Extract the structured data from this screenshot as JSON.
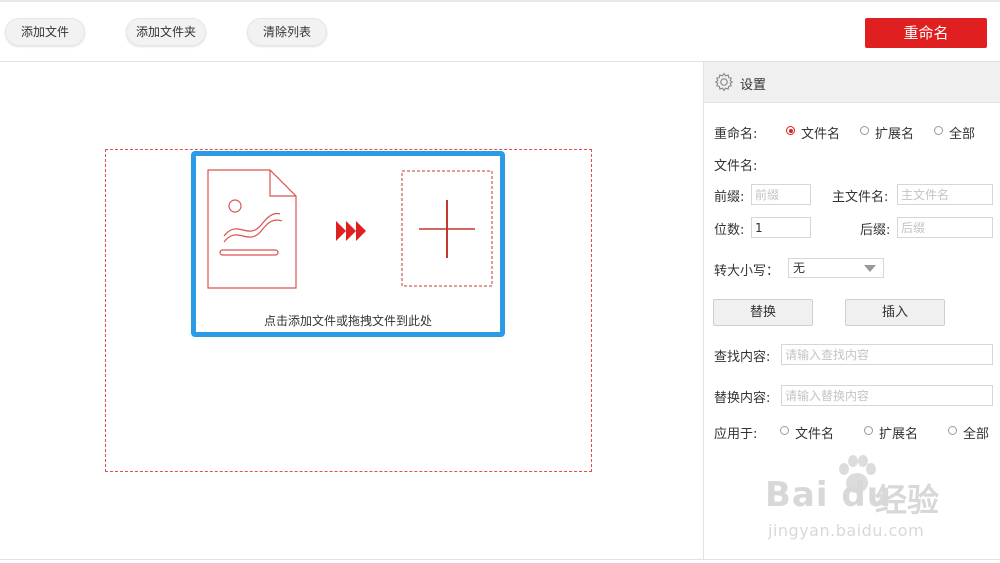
{
  "toolbar": {
    "add_file": "添加文件",
    "add_folder": "添加文件夹",
    "clear_list": "清除列表",
    "rename": "重命名"
  },
  "drop": {
    "hint": "点击添加文件或拖拽文件到此处"
  },
  "settings": {
    "title": "设置",
    "rename_mode_label": "重命名:",
    "rename_modes": [
      "文件名",
      "扩展名",
      "全部"
    ],
    "rename_mode_selected": "文件名",
    "filename_section": "文件名:",
    "prefix_label": "前缀:",
    "prefix_placeholder": "前缀",
    "mainname_label": "主文件名:",
    "mainname_placeholder": "主文件名",
    "digits_label": "位数:",
    "digits_value": "1",
    "suffix_label": "后缀:",
    "suffix_placeholder": "后缀",
    "case_label": "转大小写：",
    "case_value": "无",
    "replace_button": "替换",
    "insert_button": "插入",
    "find_label": "查找内容:",
    "find_placeholder": "请输入查找内容",
    "replace_label": "替换内容:",
    "replace_placeholder": "请输入替换内容",
    "apply_label": "应用于:",
    "apply_options": [
      "文件名",
      "扩展名",
      "全部"
    ]
  },
  "watermark": {
    "brand": "Bai du",
    "brand_cn": "经验",
    "url": "jingyan.baidu.com"
  },
  "colors": {
    "accent_red": "#e02020",
    "drop_border_blue": "#2b9be8"
  }
}
